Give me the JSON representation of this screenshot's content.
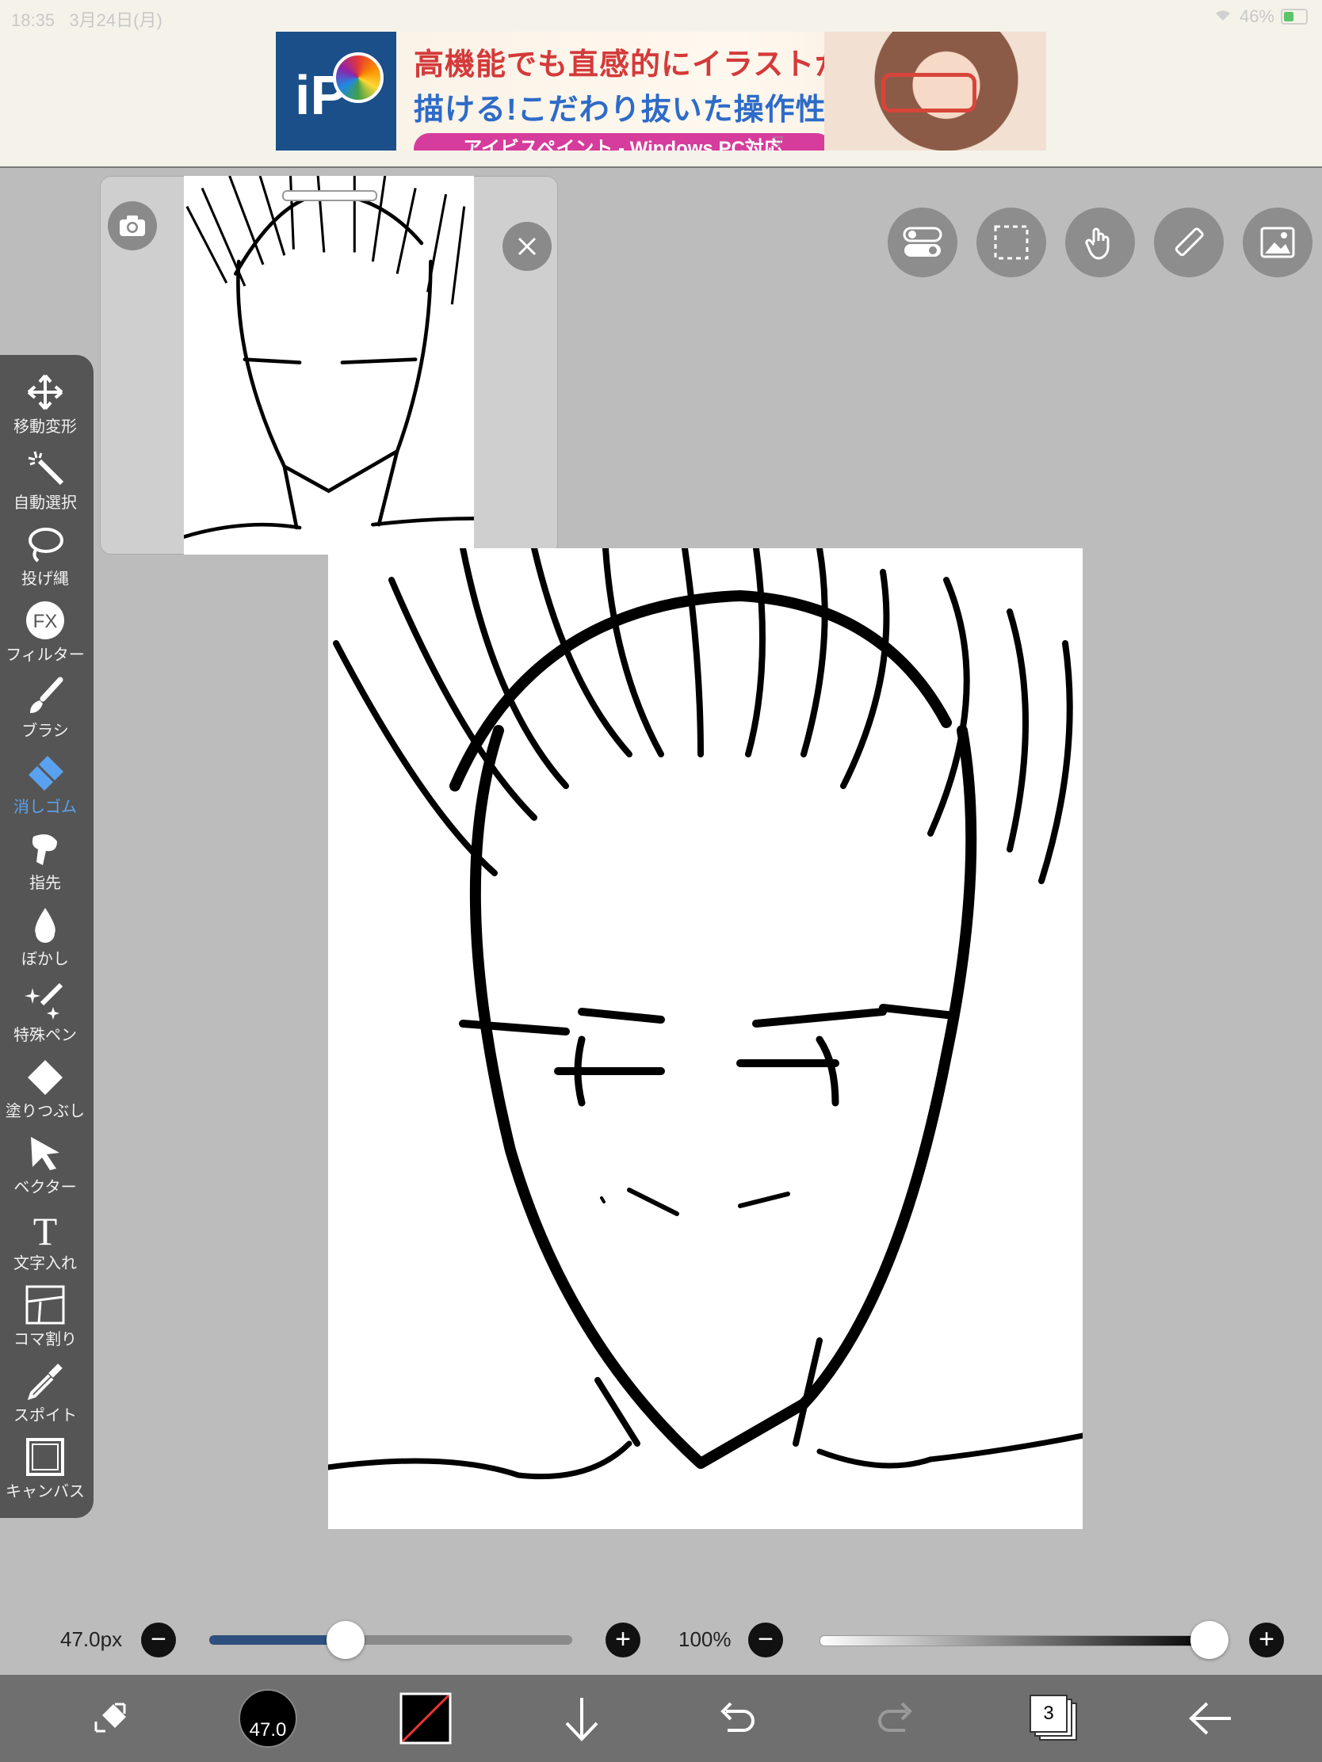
{
  "status": {
    "time": "18:35",
    "date": "3月24日(月)",
    "battery": "46%"
  },
  "ad": {
    "line1": "高機能でも直感的にイラストが",
    "line2": "描ける!こだわり抜いた操作性!",
    "pill": "アイビスペイント - Windows PC対応",
    "logo": "iP"
  },
  "navigator": {
    "camera_icon": "camera-icon",
    "close_icon": "close-icon"
  },
  "top_buttons": [
    "toggle-icon",
    "selection-icon",
    "hand-icon",
    "ruler-icon",
    "image-icon"
  ],
  "tools": [
    {
      "label": "移動変形",
      "icon": "move-icon"
    },
    {
      "label": "自動選択",
      "icon": "magic-wand-icon"
    },
    {
      "label": "投げ縄",
      "icon": "lasso-icon"
    },
    {
      "label": "フィルター",
      "icon": "fx-icon"
    },
    {
      "label": "ブラシ",
      "icon": "brush-icon"
    },
    {
      "label": "消しゴム",
      "icon": "eraser-icon"
    },
    {
      "label": "指先",
      "icon": "finger-icon"
    },
    {
      "label": "ぼかし",
      "icon": "blur-icon"
    },
    {
      "label": "特殊ペン",
      "icon": "special-pen-icon"
    },
    {
      "label": "塗りつぶし",
      "icon": "fill-icon"
    },
    {
      "label": "ベクター",
      "icon": "vector-icon"
    },
    {
      "label": "文字入れ",
      "icon": "text-icon"
    },
    {
      "label": "コマ割り",
      "icon": "panel-icon"
    },
    {
      "label": "スポイト",
      "icon": "eyedropper-icon"
    },
    {
      "label": "キャンバス",
      "icon": "canvas-icon"
    }
  ],
  "active_tool": "消しゴム",
  "fx_text": "FX",
  "text_tool_glyph": "T",
  "size_slider": {
    "label": "47.0px",
    "value_fraction": 0.37
  },
  "opacity_slider": {
    "label": "100%",
    "value_fraction": 1.0
  },
  "bottom": {
    "brush_size": "47.0",
    "layers_count": "3"
  },
  "colors": {
    "active": "#5aa2ef",
    "toolbar": "#555555",
    "canvas_bg": "#bcbcbc"
  }
}
